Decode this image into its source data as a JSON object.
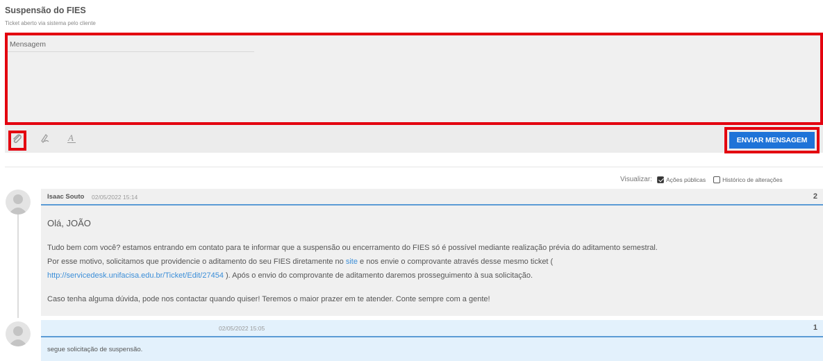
{
  "ticket": {
    "title": "Suspensão do FIES",
    "subtitle": "Ticket aberto via sistema pelo cliente"
  },
  "editor": {
    "label": "Mensagem",
    "value": ""
  },
  "toolbar": {
    "attach_icon": "paperclip-icon",
    "signature_icon": "signature-icon",
    "format_icon": "text-format-icon",
    "send_label": "ENVIAR MENSAGEM"
  },
  "view": {
    "label": "Visualizar:",
    "options": [
      {
        "label": "Ações públicas",
        "checked": true
      },
      {
        "label": "Histórico de alterações",
        "checked": false
      }
    ]
  },
  "messages": [
    {
      "author": "Isaac Souto",
      "date": "02/05/2022 15:14",
      "number": "2",
      "greeting": "Olá, JOÃO",
      "p1_line1": "Tudo bem com você? estamos entrando em contato para te informar que a suspensão ou encerramento do FIES só é possível mediante realização prévia do aditamento semestral.",
      "p1_line2_a": "Por esse motivo, solicitamos que providencie o aditamento do seu FIES diretamente no ",
      "p1_link_site": "site",
      "p1_line2_b": " e nos envie o comprovante através desse mesmo ticket (",
      "p1_link_url": "http://servicedesk.unifacisa.edu.br/Ticket/Edit/27454",
      "p1_line3": " ). Após o envio do comprovante de aditamento daremos prosseguimento à sua solicitação.",
      "p2": "Caso tenha alguma dúvida, pode nos contactar quando quiser! Teremos o maior prazer em te atender. Conte sempre com a gente!"
    },
    {
      "author": "",
      "date": "02/05/2022 15:05",
      "number": "1",
      "body": "segue solicitação de suspensão."
    }
  ],
  "colors": {
    "highlight": "#e3000f",
    "primary": "#1e73d8",
    "link": "#3b8ed8",
    "accent_line": "#5b9bd5",
    "message_client_bg": "#e3f1fc"
  }
}
